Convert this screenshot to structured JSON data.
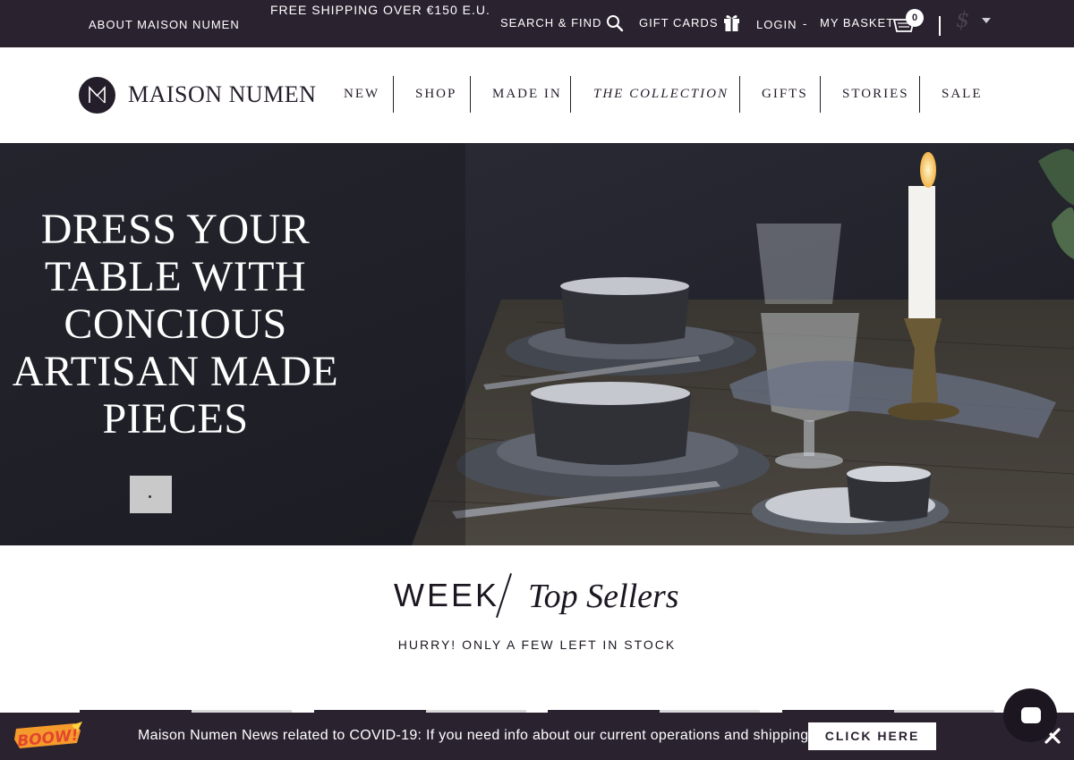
{
  "topbar": {
    "about": "ABOUT MAISON NUMEN",
    "shipping": "FREE SHIPPING OVER €150 E.U.",
    "search": "SEARCH & FIND",
    "gift_cards": "GIFT CARDS",
    "login": "LOGIN",
    "separator": "-",
    "basket": "MY BASKET",
    "basket_count": "0",
    "currency": "$"
  },
  "brand": {
    "name": "MAISON NUMEN"
  },
  "nav": {
    "items": [
      {
        "label": "NEW"
      },
      {
        "label": "SHOP"
      },
      {
        "label": "MADE IN"
      },
      {
        "label": "THE COLLECTION"
      },
      {
        "label": "GIFTS"
      },
      {
        "label": "STORIES"
      },
      {
        "label": "SALE"
      }
    ]
  },
  "hero": {
    "lines": [
      "DRESS YOUR",
      "TABLE WITH",
      "CONCIOUS",
      "ARTISAN MADE",
      "PIECES"
    ]
  },
  "section": {
    "week": "WEEK",
    "top_sellers": "Top Sellers",
    "subtitle": "HURRY! ONLY A FEW LEFT IN STOCK"
  },
  "banner": {
    "badge": "BOOW!",
    "message": "Maison Numen News related to COVID-19: If you need info about our current operations and shipping",
    "cta": "CLICK HERE"
  },
  "icons": {
    "search": "search-icon",
    "gift": "gift-icon",
    "basket": "basket-icon",
    "close": "close-icon",
    "chat": "chat-icon",
    "logo": "logo-mark-icon"
  },
  "colors": {
    "topbar_bg": "#2b2230",
    "text_dark": "#241d2a",
    "white": "#ffffff"
  }
}
